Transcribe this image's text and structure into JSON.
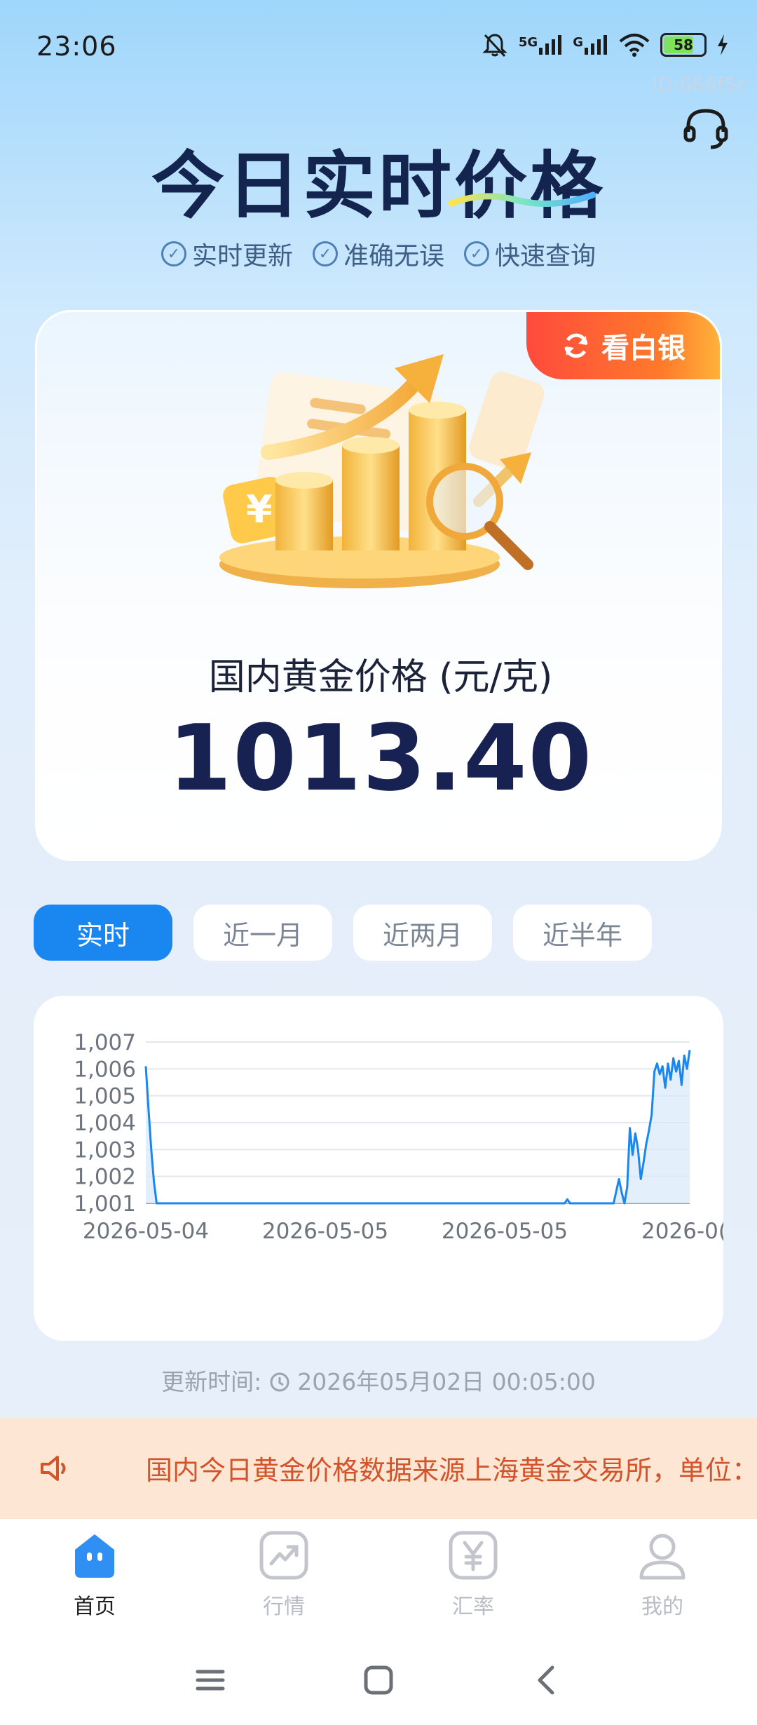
{
  "status_bar": {
    "time": "23:06",
    "network_1": "5G",
    "network_2": "G",
    "battery": "58"
  },
  "device_id": "ID:666f5c",
  "hero": {
    "title": "今日实时价格",
    "tags": [
      "实时更新",
      "准确无误",
      "快速查询"
    ]
  },
  "price_card": {
    "badge_label": "看白银",
    "label": "国内黄金价格 (元/克)",
    "value": "1013.40"
  },
  "tabs": [
    {
      "label": "实时",
      "active": true
    },
    {
      "label": "近一月",
      "active": false
    },
    {
      "label": "近两月",
      "active": false
    },
    {
      "label": "近半年",
      "active": false
    }
  ],
  "chart_data": {
    "type": "area",
    "ylim": [
      1001,
      1007
    ],
    "y_ticks": [
      "1,007",
      "1,006",
      "1,005",
      "1,004",
      "1,003",
      "1,002",
      "1,001"
    ],
    "x_tick_labels": [
      "2026-05-04",
      "2026-05-05",
      "2026-05-05",
      "2026-0("
    ],
    "color": "#1a86f0",
    "grid": true,
    "x": [
      0,
      0.005,
      0.01,
      0.015,
      0.02,
      0.03,
      0.77,
      0.775,
      0.78,
      0.86,
      0.87,
      0.875,
      0.88,
      0.885,
      0.89,
      0.895,
      0.9,
      0.905,
      0.91,
      0.915,
      0.92,
      0.925,
      0.93,
      0.935,
      0.94,
      0.945,
      0.95,
      0.955,
      0.96,
      0.965,
      0.97,
      0.975,
      0.98,
      0.985,
      0.99,
      0.995,
      1.0
    ],
    "y": [
      1006.1,
      1004.5,
      1003.0,
      1001.8,
      1001.0,
      1001.0,
      1001.0,
      1001.15,
      1001.0,
      1001.0,
      1001.9,
      1001.4,
      1001.0,
      1001.6,
      1003.8,
      1002.8,
      1003.6,
      1003.0,
      1001.9,
      1002.5,
      1003.2,
      1003.7,
      1004.3,
      1005.9,
      1006.2,
      1005.8,
      1006.1,
      1005.3,
      1006.2,
      1005.6,
      1006.4,
      1005.9,
      1006.3,
      1005.4,
      1006.5,
      1006.0,
      1006.7
    ]
  },
  "update_time": {
    "label": "更新时间:",
    "value": "2026年05月02日 00:05:00"
  },
  "notice": {
    "text": "国内今日黄金价格数据来源上海黄金交易所，单位：元/克"
  },
  "bottom_nav": [
    {
      "label": "首页",
      "icon": "home-icon",
      "active": true
    },
    {
      "label": "行情",
      "icon": "trend-icon",
      "active": false
    },
    {
      "label": "汇率",
      "icon": "yen-icon",
      "active": false
    },
    {
      "label": "我的",
      "icon": "user-icon",
      "active": false
    }
  ],
  "colors": {
    "accent": "#1a86f0",
    "price_text": "#172152",
    "badge": "#ff4a3d",
    "notice_text": "#d1542a",
    "notice_bg": "#fde6d3"
  }
}
